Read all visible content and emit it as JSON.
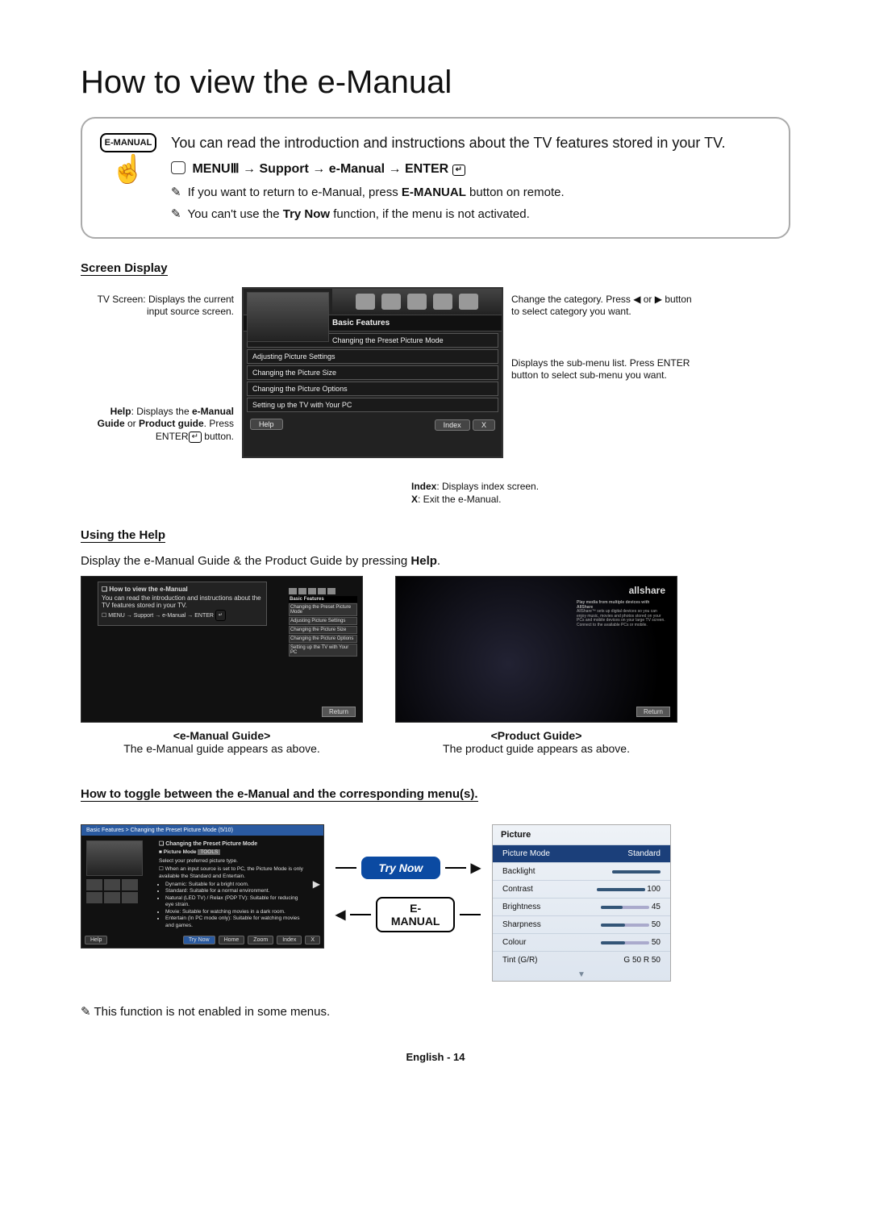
{
  "title": "How to view the e-Manual",
  "intro": {
    "remote_button_label": "E-MANUAL",
    "body": "You can read the introduction and instructions about the TV features stored in your TV.",
    "path_prefix": "MENU",
    "path_arrow": "→",
    "path_step1": "Support",
    "path_step2": "e-Manual",
    "path_enter": "ENTER",
    "note1_prefix": "If you want to return to e-Manual, press ",
    "note1_bold": "E-MANUAL",
    "note1_suffix": " button on remote.",
    "note2_prefix": "You can't use the ",
    "note2_bold": "Try Now",
    "note2_suffix": " function, if the menu is not activated."
  },
  "screen_display": {
    "heading": "Screen Display",
    "left_callout1": "TV Screen: Displays the current input source screen.",
    "left_callout2_pre": "Help",
    "left_callout2_mid": ": Displays the ",
    "left_callout2_bold1": "e-Manual Guide",
    "left_callout2_or": " or ",
    "left_callout2_bold2": "Product guide",
    "left_callout2_suf": ". Press ENTER",
    "left_callout2_tail": " button.",
    "right_callout1": "Change the category. Press ◀ or ▶ button to select category you want.",
    "right_callout2": "Displays the sub-menu list. Press ENTER  button to select sub-menu you want.",
    "basic_features_label": "Basic Features",
    "menu_items": [
      "Changing the Preset Picture Mode",
      "Adjusting Picture Settings",
      "Changing the Picture Size",
      "Changing the Picture Options",
      "Setting up the TV with Your PC"
    ],
    "bottom_help": "Help",
    "bottom_index": "Index",
    "bottom_x": "X",
    "index_callout_1": "Index",
    "index_callout_1b": ": Displays index screen.",
    "index_callout_2": "X",
    "index_callout_2b": ": Exit the e-Manual."
  },
  "using_help": {
    "heading": "Using the Help",
    "desc_pre": "Display the e-Manual Guide & the Product Guide by pressing ",
    "desc_bold": "Help",
    "desc_suf": ".",
    "shot1_title": "How to view the e-Manual",
    "shot1_line1": "You can read the introduction and instructions about the TV features stored in your TV.",
    "shot1_path": "MENU → Support → e-Manual → ENTER",
    "mini_bar_label": "Basic Features",
    "mini_items": [
      "Changing the Preset Picture Mode",
      "Adjusting Picture Settings",
      "Changing the Picture Size",
      "Changing the Picture Options",
      "Setting up the TV with Your PC"
    ],
    "return_label": "Return",
    "allshare_logo": "allshare",
    "allshare_title": "Play media from multiple devices with AllShare",
    "allshare_blurb": "AllShare™ sets up digital devices so you can enjoy music, movies and photos stored on your PCs and mobile devices on your large TV screen. Connect to the available PCs or mobile.",
    "cap1_title": "<e-Manual Guide>",
    "cap1_line": "The e-Manual guide appears as above.",
    "cap2_title": "<Product Guide>",
    "cap2_line": "The product guide appears as above."
  },
  "toggle": {
    "heading": "How to toggle between the e-Manual and the corresponding menu(s).",
    "crumb": "Basic Features > Changing the Preset Picture Mode (5/10)",
    "tl_hdr": "Changing the Preset Picture Mode",
    "tl_pm_label": "Picture Mode",
    "tl_pm_value": "TOOLS",
    "tl_line0": "Select your preferred picture type.",
    "tl_note": "When an input source is set to PC, the Picture Mode is only available the Standard and Entertain.",
    "tl_items": [
      "Dynamic: Suitable for a bright room.",
      "Standard: Suitable for a normal environment.",
      "Natural (LED TV) / Relax (PDP TV): Suitable for reducing eye strain.",
      "Movie: Suitable for watching movies in a dark room.",
      "Entertain (In PC mode only): Suitable for watching movies and games."
    ],
    "footer_help": "Help",
    "footer_trynow": "Try Now",
    "footer_home": "Home",
    "footer_zoom": "Zoom",
    "footer_index": "Index",
    "footer_x": "X",
    "btn_trynow": "Try Now",
    "btn_emanual": "E-MANUAL",
    "picture_menu": {
      "title": "Picture",
      "rows": [
        {
          "label": "Picture Mode",
          "value": "Standard",
          "selected": true
        },
        {
          "label": "Backlight",
          "value": "",
          "slider": 100
        },
        {
          "label": "Contrast",
          "value": "100",
          "slider": 100
        },
        {
          "label": "Brightness",
          "value": "45",
          "slider": 45
        },
        {
          "label": "Sharpness",
          "value": "50",
          "slider": 50
        },
        {
          "label": "Colour",
          "value": "50",
          "slider": 50
        },
        {
          "label": "Tint (G/R)",
          "value": "G 50       R 50"
        }
      ]
    }
  },
  "footer_note_pre": "This function is not enabled in some menus.",
  "page_footer": "English - 14"
}
